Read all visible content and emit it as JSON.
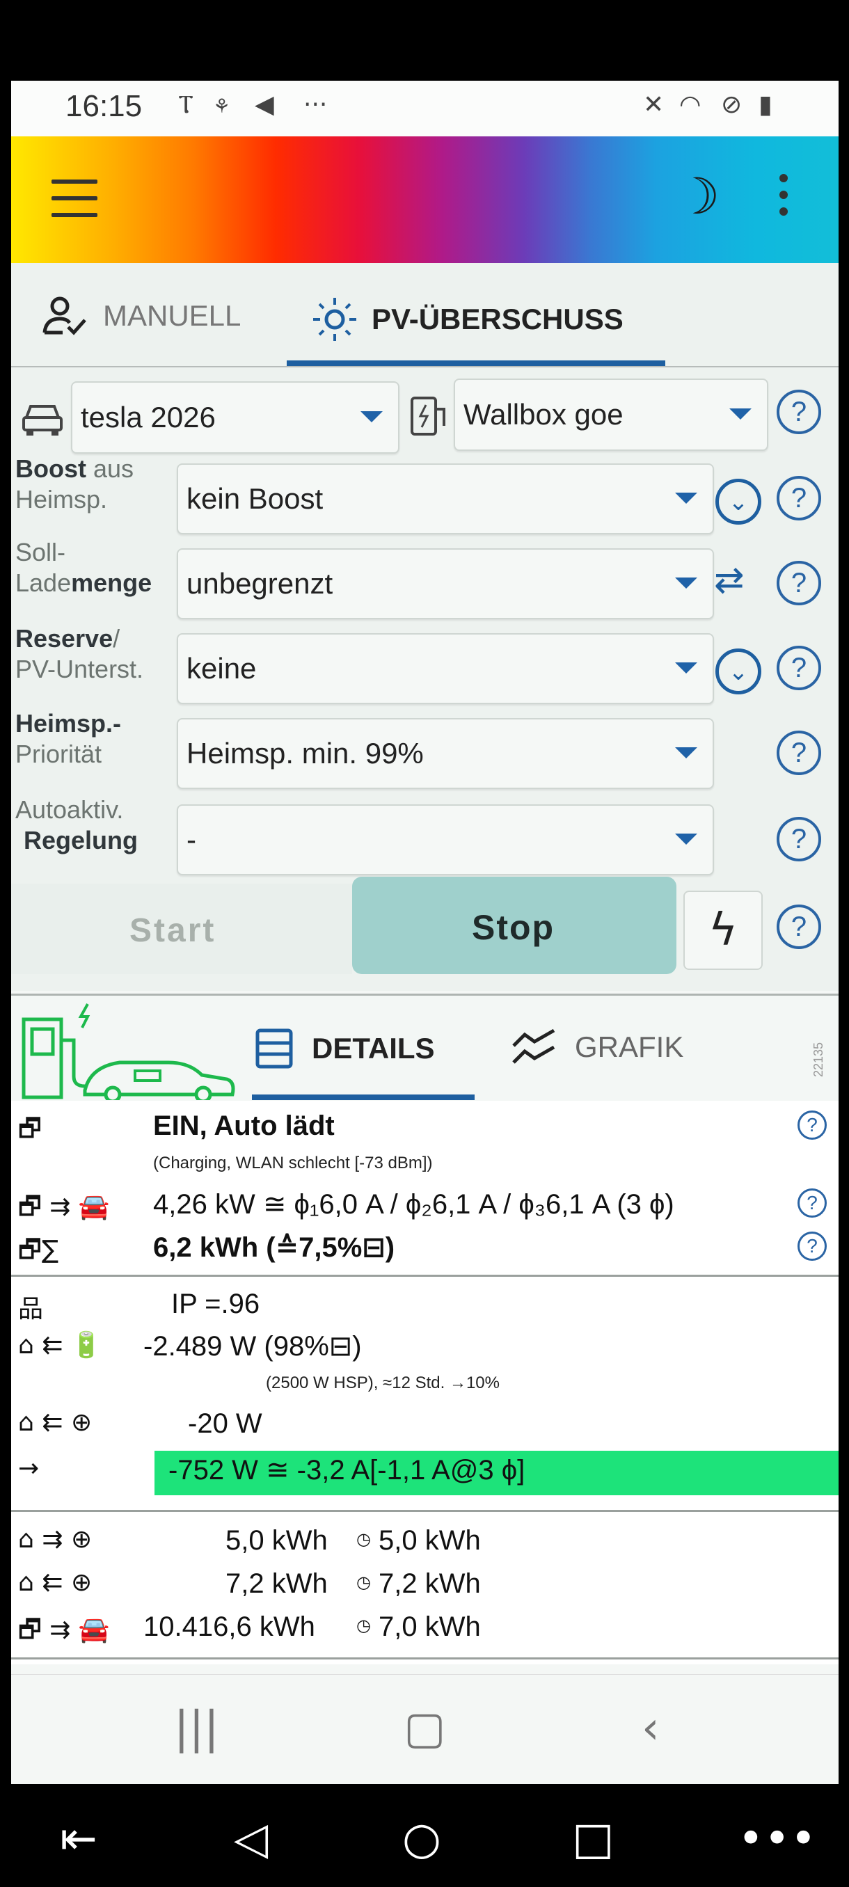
{
  "status_bar": {
    "time": "16:15",
    "left_icons": "὚7 ⚡ ➤ ···",
    "right_icons": "🔇 📶 ⊘ 🔋"
  },
  "header": {
    "menu_icon": "hamburger-icon",
    "theme_icon": "moon-icon",
    "more_icon": "kebab-icon"
  },
  "mode_tabs": [
    {
      "label": "MANUELL",
      "icon": "person-check-icon",
      "active": false
    },
    {
      "label": "PV-ÜBERSCHUSS",
      "icon": "sun-icon",
      "active": true
    }
  ],
  "settings": {
    "vehicle": "tesla 2026",
    "wallbox": "Wallbox goe",
    "rows": [
      {
        "label_bold": "Boost",
        "label_rest": " aus",
        "label2": "Heimsp.",
        "value": "kein Boost"
      },
      {
        "label_line1": "Soll-",
        "label2_plain": "Lade",
        "label2_bold": "menge",
        "value": "unbegrenzt"
      },
      {
        "label_bold": "Reserve",
        "label_rest": "/",
        "label2": "PV-Unterst.",
        "value": "keine"
      },
      {
        "label_bold": "Heimsp.",
        "label_rest": "-",
        "label2": "Priorität",
        "value": "Heimsp. min. 99%"
      },
      {
        "label_line1": "Autoaktiv.",
        "label2_bold": "Regelung",
        "value": "-"
      }
    ],
    "start_label": "Start",
    "stop_label": "Stop",
    "help_glyph": "?"
  },
  "detail_tabs": [
    {
      "label": "DETAILS",
      "active": true
    },
    {
      "label": "GRAFIK",
      "active": false
    }
  ],
  "version_text": "22135",
  "details": {
    "status_title": "EIN, Auto lädt",
    "status_sub": "(Charging, WLAN schlecht [-73 dBm])",
    "power_line": "4,26 kW ≅ ϕ₁6,0 A / ϕ₂6,1 A / ϕ₃6,1 A (3 ϕ)",
    "energy_line": "6,2 kWh (≙7,5%⊟)",
    "ip_line": "IP =.96",
    "battery_line": "-2.489 W (98%⊟)",
    "battery_sub": "(2500 W HSP), ≈12 Std. →10%",
    "grid_line": "-20 W",
    "surplus_line": "-752 W ≅ -3,2 A[-1,1 A@3 ϕ]",
    "export_val": "5,0 kWh",
    "export_today": "5,0 kWh",
    "import_val": "7,2 kWh",
    "import_today": "7,2 kWh",
    "charged_val": "10.416,6 kWh",
    "charged_today": "7,0 kWh"
  },
  "symbols": {
    "wallbox": "🗗",
    "sum": "∑",
    "flow_out": "⇉",
    "flow_in": "⇇",
    "network": "品",
    "house": "⌂",
    "globe": "⊕",
    "arrow": "→",
    "clock": "◷"
  },
  "colors": {
    "accent": "#1e5fa0",
    "surplus_green": "#1de37a",
    "stop_button": "#9fd0cc"
  }
}
